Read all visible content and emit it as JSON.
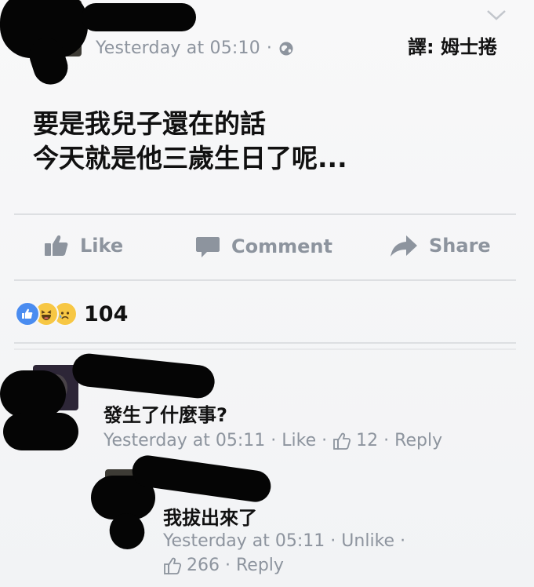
{
  "colors": {
    "meta": "#8d949e",
    "text": "#111111",
    "divider": "#dddfe2",
    "like_blue": "#4a8cf0",
    "emoji_yellow": "#f7c744"
  },
  "post": {
    "timestamp": "Yesterday at 05:10",
    "separator": "·",
    "privacy_icon": "globe-icon",
    "menu_icon": "chevron-down-icon",
    "translator_credit": "譯: 姆士捲",
    "lines": [
      "要是我兒子還在的話",
      "今天就是他三歲生日了呢..."
    ]
  },
  "actions": {
    "like": "Like",
    "comment": "Comment",
    "share": "Share"
  },
  "reactions": {
    "icons": [
      "like-reaction-icon",
      "haha-reaction-icon",
      "sad-reaction-icon"
    ],
    "count": "104"
  },
  "comments": [
    {
      "text": "發生了什麼事?",
      "timestamp": "Yesterday at 05:11",
      "like_label": "Like",
      "like_count": "12",
      "reply_label": "Reply"
    },
    {
      "text": "我拔出來了",
      "timestamp": "Yesterday at 05:11",
      "unlike_label": "Unlike",
      "like_count": "266",
      "reply_label": "Reply"
    }
  ]
}
